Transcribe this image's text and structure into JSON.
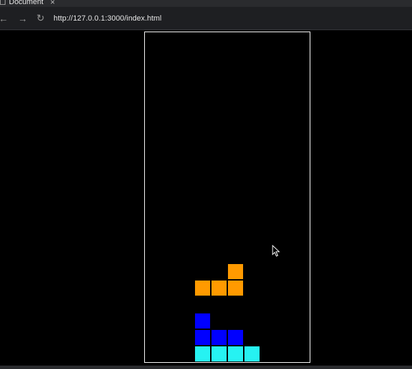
{
  "browser": {
    "tab_title": "Document",
    "tab_close": "×",
    "url": "http://127.0.0.1:3000/index.html",
    "back_icon": "←",
    "forward_icon": "→",
    "reload_icon": "↻"
  },
  "game": {
    "board_columns": 10,
    "board_rows": 20,
    "colors": {
      "orange": "#ff9a00",
      "blue": "#0000ff",
      "cyan": "#26f2f2",
      "board_border": "#ffffff",
      "background": "#000000"
    },
    "pieces": [
      {
        "name": "falling-l-piece",
        "color": "orange",
        "cells": [
          [
            5,
            14
          ],
          [
            3,
            15
          ],
          [
            4,
            15
          ],
          [
            5,
            15
          ]
        ]
      },
      {
        "name": "placed-j-piece",
        "color": "blue",
        "cells": [
          [
            3,
            17
          ],
          [
            3,
            18
          ],
          [
            4,
            18
          ],
          [
            5,
            18
          ]
        ]
      },
      {
        "name": "placed-i-piece",
        "color": "cyan",
        "cells": [
          [
            3,
            19
          ],
          [
            4,
            19
          ],
          [
            5,
            19
          ],
          [
            6,
            19
          ]
        ]
      }
    ]
  }
}
